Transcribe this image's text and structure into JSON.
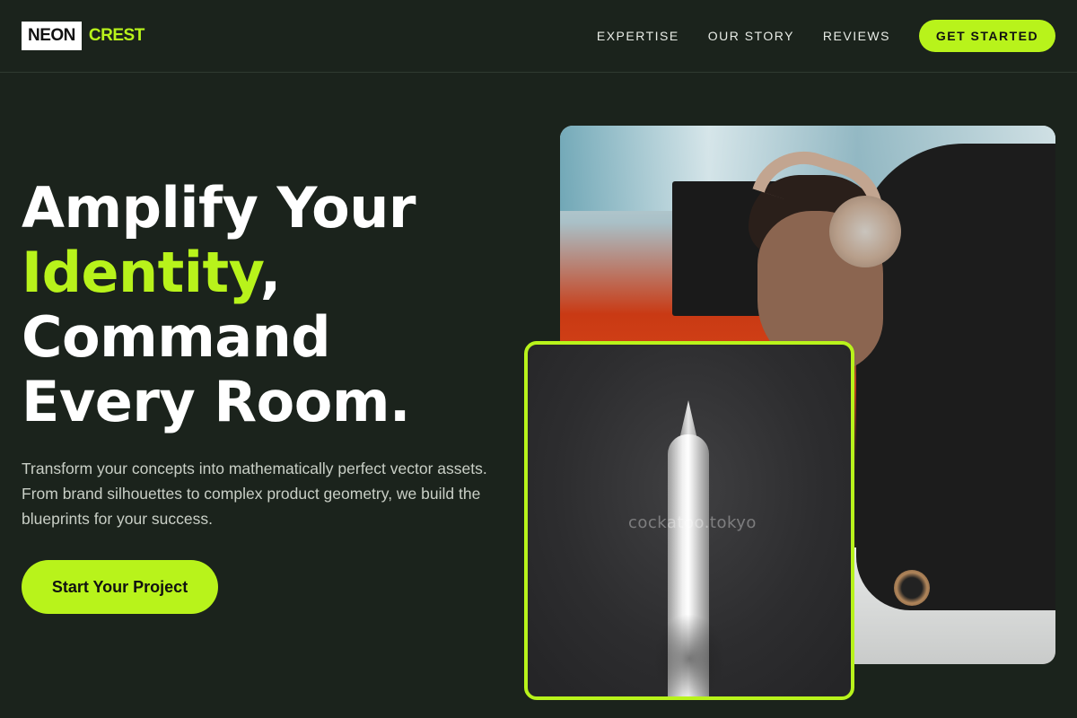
{
  "brand": {
    "logo_boxed": "NEON",
    "logo_accent": "CREST"
  },
  "nav": {
    "links": [
      "EXPERTISE",
      "OUR STORY",
      "REVIEWS"
    ],
    "cta": "GET STARTED"
  },
  "hero": {
    "headline_line1": "Amplify Your",
    "headline_accent": "Identity",
    "headline_comma": ",",
    "headline_line3": "Command",
    "headline_line4": "Every Room.",
    "subtext": "Transform your concepts into mathematically perfect vector assets. From brand silhouettes to complex product geometry, we build the blueprints for your success.",
    "cta": "Start Your Project"
  },
  "images": {
    "watermark": "cockatoo.tokyo",
    "watermark_partial": "tokyo"
  },
  "colors": {
    "background": "#1b231c",
    "accent": "#b8f31b",
    "text": "#ffffff",
    "muted_text": "#c9cfc6"
  }
}
